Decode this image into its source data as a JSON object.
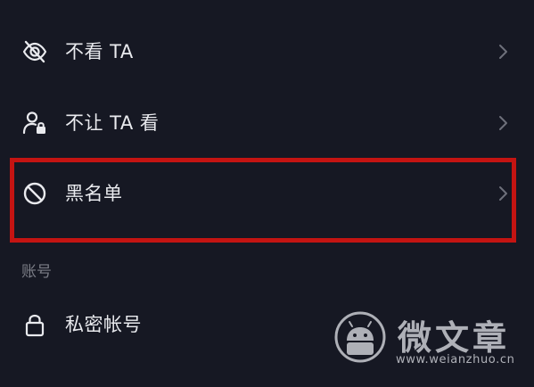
{
  "rows": [
    {
      "label": "不看 TA",
      "icon": "eye-off-icon"
    },
    {
      "label": "不让 TA 看",
      "icon": "user-lock-icon"
    },
    {
      "label": "黑名单",
      "icon": "block-icon"
    }
  ],
  "section": {
    "title": "账号"
  },
  "account_rows": [
    {
      "label": "私密帐号",
      "icon": "lock-icon"
    }
  ],
  "watermark": {
    "name": "微文章",
    "url": "www.weianzhuo.cn"
  },
  "colors": {
    "background": "#161823",
    "text": "#e9eaee",
    "muted": "#7b7d86",
    "highlight": "#c41412"
  }
}
